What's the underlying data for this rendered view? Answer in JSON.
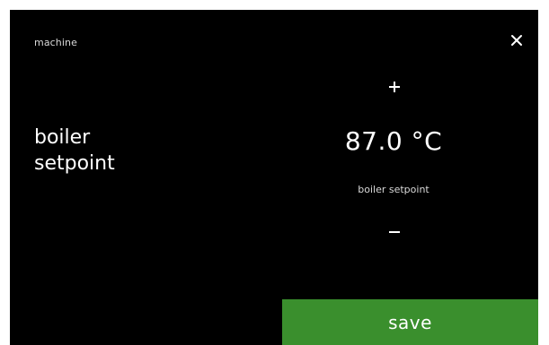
{
  "header": {
    "section": "machine",
    "close_icon": "close-icon"
  },
  "parameter": {
    "label_line1": "boiler",
    "label_line2": "setpoint",
    "value": "87.0 °C",
    "caption": "boiler setpoint"
  },
  "controls": {
    "increase_icon": "plus-icon",
    "decrease_icon": "minus-icon",
    "save_label": "save"
  },
  "colors": {
    "background": "#000000",
    "text": "#ffffff",
    "save_button": "#3a8f2d"
  }
}
